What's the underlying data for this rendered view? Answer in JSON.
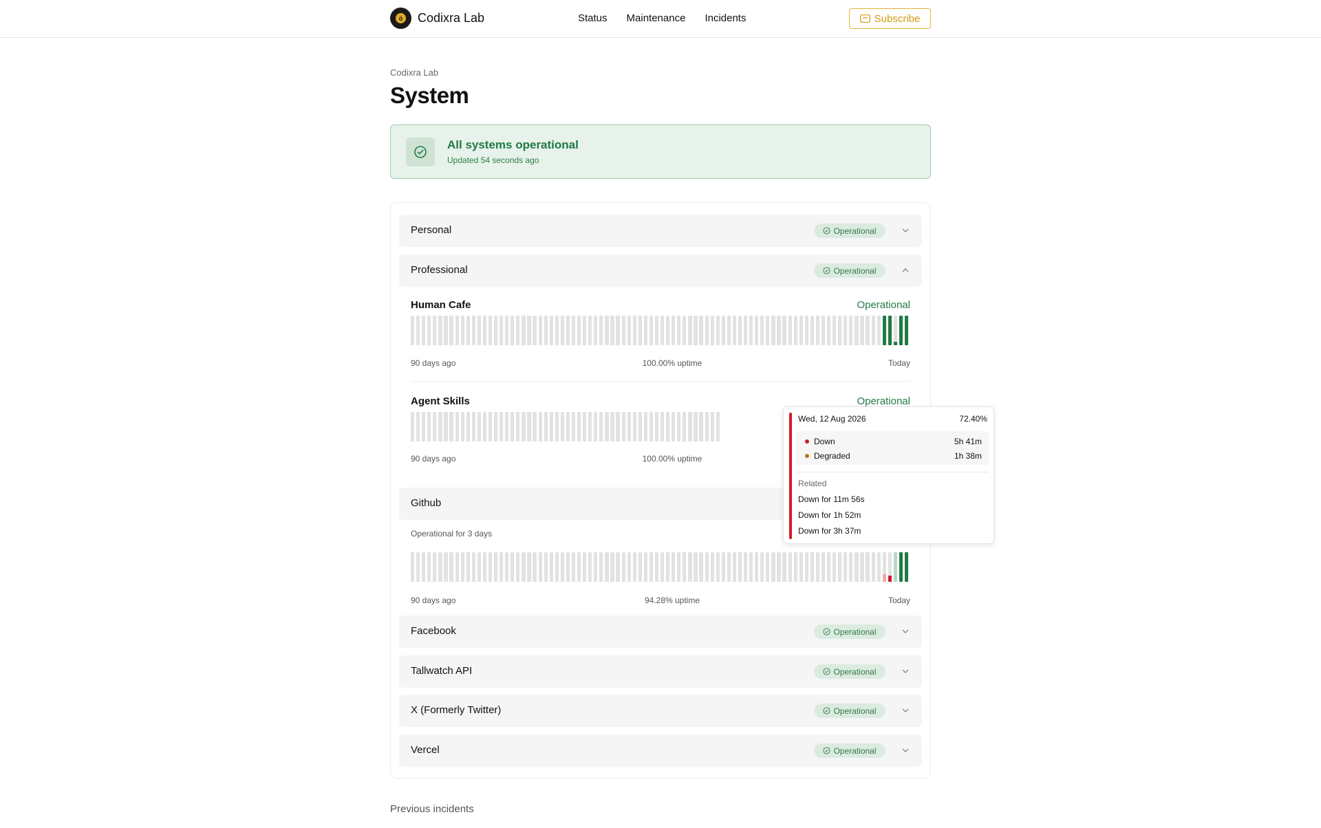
{
  "header": {
    "brand_name": "Codixra Lab",
    "nav": [
      "Status",
      "Maintenance",
      "Incidents"
    ],
    "subscribe_label": "Subscribe"
  },
  "page": {
    "breadcrumb": "Codixra Lab",
    "title": "System"
  },
  "banner": {
    "title": "All systems operational",
    "updated": "Updated 54 seconds ago"
  },
  "groups": {
    "personal": {
      "name": "Personal",
      "status": "Operational"
    },
    "professional": {
      "name": "Professional",
      "status": "Operational"
    },
    "facebook": {
      "name": "Facebook",
      "status": "Operational"
    },
    "tallwatch": {
      "name": "Tallwatch API",
      "status": "Operational"
    },
    "x": {
      "name": "X (Formerly Twitter)",
      "status": "Operational"
    },
    "vercel": {
      "name": "Vercel",
      "status": "Operational"
    }
  },
  "services": {
    "human_cafe": {
      "name": "Human Cafe",
      "status": "Operational",
      "left_label": "90 days ago",
      "uptime": "100.00% uptime",
      "right_label": "Today",
      "recent_days": [
        "up",
        "up",
        "partial-up",
        "up",
        "up"
      ]
    },
    "agent_skills": {
      "name": "Agent Skills",
      "status": "Operational",
      "left_label": "90 days ago",
      "uptime": "100.00% uptime"
    },
    "github": {
      "name": "Github",
      "subtitle": "Operational for 3 days",
      "left_label": "90 days ago",
      "uptime": "94.28% uptime",
      "right_label": "Today",
      "recent_days": [
        "down-light",
        "down",
        "degraded-light",
        "up",
        "up"
      ]
    }
  },
  "tooltip": {
    "date": "Wed, 12 Aug 2026",
    "percent": "72.40%",
    "rows": [
      {
        "label": "Down",
        "value": "5h 41m",
        "color": "#d11a2a"
      },
      {
        "label": "Degraded",
        "value": "1h 38m",
        "color": "#b5791b"
      }
    ],
    "related_label": "Related",
    "related": [
      "Down for 11m 56s",
      "Down for 1h 52m",
      "Down for 3h 37m"
    ]
  },
  "footer": {
    "previous_incidents": "Previous incidents"
  },
  "colors": {
    "operational": "#1f7a43",
    "bar_empty": "#e2e2e2",
    "bar_up": "#1f7a43",
    "bar_down": "#d11a2a",
    "accent": "#d49a12"
  }
}
